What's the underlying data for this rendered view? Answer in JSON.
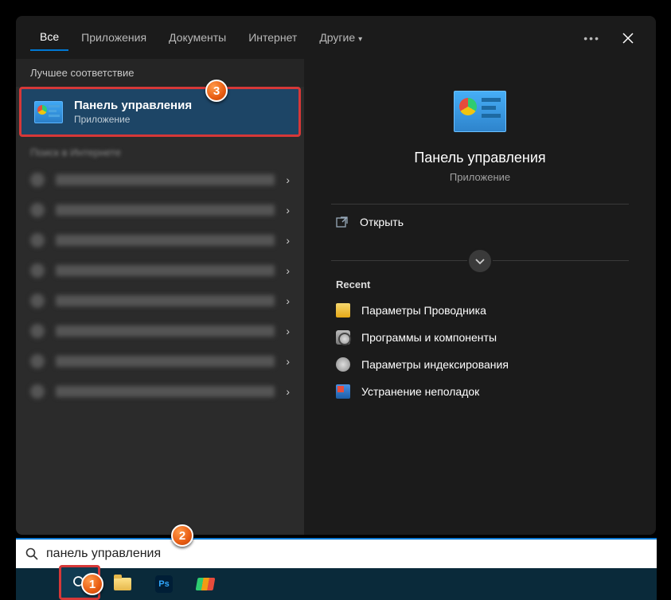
{
  "tabs": {
    "all": "Все",
    "apps": "Приложения",
    "docs": "Документы",
    "web": "Интернет",
    "more": "Другие"
  },
  "section_best": "Лучшее соответствие",
  "best_match": {
    "title": "Панель управления",
    "subtitle": "Приложение"
  },
  "section_web": "Поиск в Интернете",
  "preview": {
    "title": "Панель управления",
    "subtitle": "Приложение",
    "open": "Открыть",
    "recent_hdr": "Recent",
    "recent": [
      "Параметры Проводника",
      "Программы и компоненты",
      "Параметры индексирования",
      "Устранение неполадок"
    ]
  },
  "search_value": "панель управления",
  "taskbar": {
    "ps": "Ps"
  },
  "badges": {
    "b1": "1",
    "b2": "2",
    "b3": "3"
  }
}
